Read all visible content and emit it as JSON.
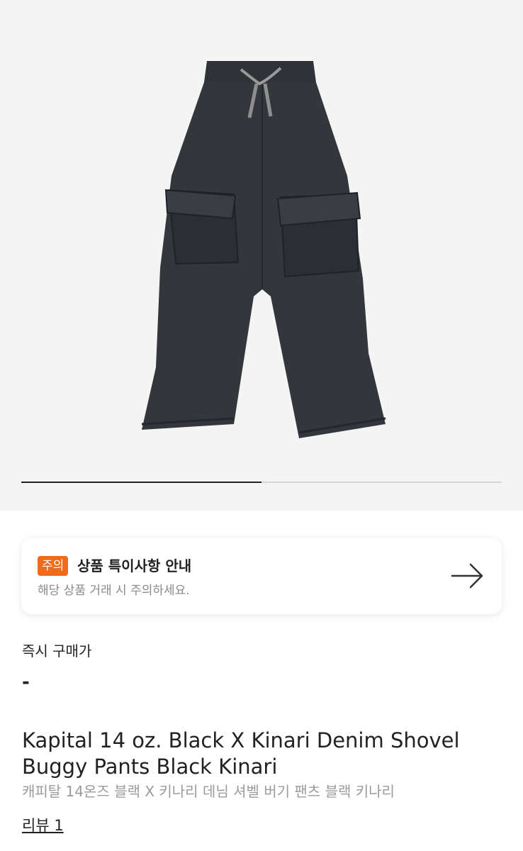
{
  "gallery": {
    "image_alt": "product-photo",
    "progress": 0.5
  },
  "notice": {
    "badge": "주의",
    "title": "상품 특이사항 안내",
    "subtitle": "해당 상품 거래 시 주의하세요.",
    "icon": "arrow-right-icon"
  },
  "price": {
    "label": "즉시 구매가",
    "value": "-"
  },
  "product": {
    "title": "Kapital 14 oz. Black X Kinari Denim Shovel Buggy Pants Black Kinari",
    "subtitle": "캐피탈 14온즈 블랙 X 키나리 데님 셔벨 버기 팬츠 블랙 키나리"
  },
  "review": {
    "label": "리뷰 1"
  },
  "colors": {
    "accent": "#ef6b1a",
    "gallery_bg": "#f4f4f4",
    "denim": "#33363b"
  }
}
